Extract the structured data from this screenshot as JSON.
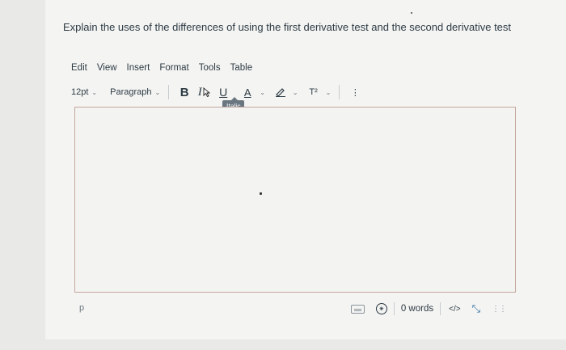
{
  "question": {
    "text": "Explain the uses of the differences of using the first derivative test and the second derivative test"
  },
  "menubar": {
    "items": [
      "Edit",
      "View",
      "Insert",
      "Format",
      "Tools",
      "Table"
    ]
  },
  "toolbar": {
    "font_size": "12pt",
    "block_format": "Paragraph",
    "bold_label": "B",
    "italic_label": "I",
    "underline_label": "U",
    "text_color_label": "A",
    "superscript_label": "T²",
    "more_label": "⋮",
    "tooltip": "Italic"
  },
  "editor": {
    "content": ""
  },
  "statusbar": {
    "path": "p",
    "word_count": "0 words",
    "html_toggle": "</>"
  }
}
